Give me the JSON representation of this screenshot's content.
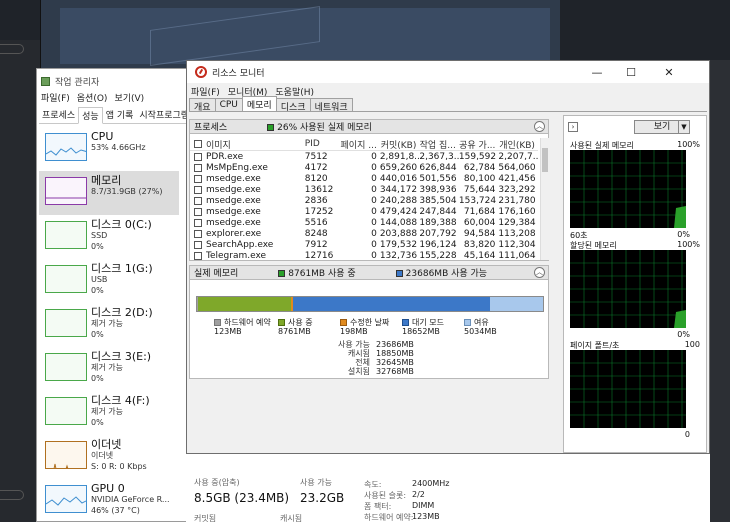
{
  "task_manager": {
    "title": "작업 관리자",
    "menu": [
      "파일(F)",
      "옵션(O)",
      "보기(V)"
    ],
    "tabs": [
      "프로세스",
      "성능",
      "앱 기록",
      "시작프로그램"
    ],
    "active_tab": 1,
    "perf_items": [
      {
        "name": "CPU",
        "sub1": "53% 4.66GHz",
        "sub2": ""
      },
      {
        "name": "메모리",
        "sub1": "8.7/31.9GB (27%)",
        "sub2": ""
      },
      {
        "name": "디스크 0(C:)",
        "sub1": "SSD",
        "sub2": "0%"
      },
      {
        "name": "디스크 1(G:)",
        "sub1": "USB",
        "sub2": "0%"
      },
      {
        "name": "디스크 2(D:)",
        "sub1": "제거 가능",
        "sub2": "0%"
      },
      {
        "name": "디스크 3(E:)",
        "sub1": "제거 가능",
        "sub2": "0%"
      },
      {
        "name": "디스크 4(F:)",
        "sub1": "제거 가능",
        "sub2": "0%"
      },
      {
        "name": "이더넷",
        "sub1": "이더넷",
        "sub2": "S: 0 R: 0 Kbps"
      },
      {
        "name": "GPU 0",
        "sub1": "NVIDIA GeForce R...",
        "sub2": "46% (37 °C)"
      }
    ],
    "bottom": {
      "in_use_label": "사용 중(압축)",
      "in_use_value": "8.5GB (23.4MB)",
      "available_label": "사용 가능",
      "available_value": "23.2GB",
      "committed_label": "커밋됨",
      "cached_label": "캐시됨",
      "speed_label": "속도:",
      "speed_value": "2400MHz",
      "slots_label": "사용된 슬롯:",
      "slots_value": "2/2",
      "form_label": "폼 팩터:",
      "form_value": "DIMM",
      "hw_reserved_label": "하드웨어 예약:",
      "hw_reserved_value": "123MB"
    }
  },
  "resource_monitor": {
    "title": "리소스 모니터",
    "menu": [
      "파일(F)",
      "모니터(M)",
      "도움말(H)"
    ],
    "tabs": [
      "개요",
      "CPU",
      "메모리",
      "디스크",
      "네트워크"
    ],
    "active_tab": 2,
    "window_buttons": {
      "minimize": "—",
      "maximize": "☐",
      "close": "✕"
    },
    "process_panel": {
      "title": "프로세스",
      "legend": "26% 사용된 실제 메모리",
      "columns": [
        "이미지",
        "PID",
        "페이지 ...",
        "커밋(KB)",
        "작업 집...",
        "공유 가...",
        "개인(KB)"
      ],
      "rows": [
        [
          "PDR.exe",
          "7512",
          "0",
          "2,891,8...",
          "2,367,3...",
          "159,592",
          "2,207,7..."
        ],
        [
          "MsMpEng.exe",
          "4172",
          "0",
          "659,260",
          "626,844",
          "62,784",
          "564,060"
        ],
        [
          "msedge.exe",
          "8120",
          "0",
          "440,016",
          "501,556",
          "80,100",
          "421,456"
        ],
        [
          "msedge.exe",
          "13612",
          "0",
          "344,172",
          "398,936",
          "75,644",
          "323,292"
        ],
        [
          "msedge.exe",
          "2836",
          "0",
          "240,288",
          "385,504",
          "153,724",
          "231,780"
        ],
        [
          "msedge.exe",
          "17252",
          "0",
          "479,424",
          "247,844",
          "71,684",
          "176,160"
        ],
        [
          "msedge.exe",
          "5516",
          "0",
          "144,088",
          "189,388",
          "60,004",
          "129,384"
        ],
        [
          "explorer.exe",
          "8248",
          "0",
          "203,888",
          "207,792",
          "94,584",
          "113,208"
        ],
        [
          "SearchApp.exe",
          "7912",
          "0",
          "179,532",
          "196,124",
          "83,820",
          "112,304"
        ],
        [
          "Telegram.exe",
          "12716",
          "0",
          "132,736",
          "155,228",
          "45,164",
          "111,064"
        ]
      ]
    },
    "memory_panel": {
      "title": "실제 메모리",
      "legend_used": "8761MB 사용 중",
      "legend_available": "23686MB 사용 가능",
      "bar": [
        {
          "key": "hw",
          "value": 123,
          "color": "#a0a0a0"
        },
        {
          "key": "used",
          "value": 8761,
          "color": "#7fa82a"
        },
        {
          "key": "modified",
          "value": 198,
          "color": "#e08a1e"
        },
        {
          "key": "standby",
          "value": 18652,
          "color": "#3c78c8"
        },
        {
          "key": "free",
          "value": 5034,
          "color": "#a8c8ec"
        }
      ],
      "legend": [
        {
          "label": "하드웨어 예약",
          "value": "123MB",
          "color": "#a0a0a0"
        },
        {
          "label": "사용 중",
          "value": "8761MB",
          "color": "#7fa82a"
        },
        {
          "label": "수정한 날짜",
          "value": "198MB",
          "color": "#e08a1e"
        },
        {
          "label": "대기 모드",
          "value": "18652MB",
          "color": "#3c78c8"
        },
        {
          "label": "여유",
          "value": "5034MB",
          "color": "#a8c8ec"
        }
      ],
      "stats": [
        {
          "label": "사용 가능",
          "value": "23686MB"
        },
        {
          "label": "캐시됨",
          "value": "18850MB"
        },
        {
          "label": "전체",
          "value": "32645MB"
        },
        {
          "label": "설치됨",
          "value": "32768MB"
        }
      ]
    },
    "graphs": {
      "view_label": "보기",
      "items": [
        {
          "title": "사용된 실제 메모리",
          "top": "100%",
          "foot_left": "60초",
          "foot_right": "0%"
        },
        {
          "title": "할당된 메모리",
          "top": "100%",
          "foot_left": "",
          "foot_right": "0%"
        },
        {
          "title": "페이지 폴트/초",
          "top": "100",
          "foot_left": "",
          "foot_right": "0"
        }
      ]
    }
  },
  "colors": {
    "accent_green": "#7fa82a",
    "graph_grid": "#0a7a2a",
    "graph_line": "#3fe06a"
  }
}
